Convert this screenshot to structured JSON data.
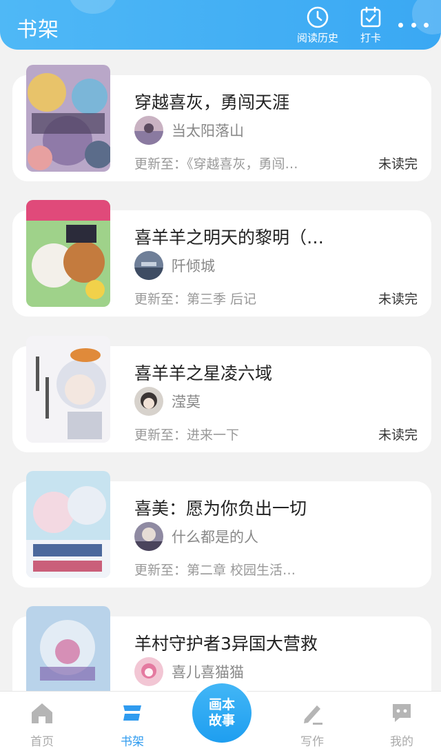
{
  "header": {
    "title": "书架",
    "history_label": "阅读历史",
    "checkin_label": "打卡"
  },
  "books": [
    {
      "title": "穿越喜灰，勇闯天涯",
      "author": "当太阳落山",
      "update": "更新至：《穿越喜灰，勇闯…",
      "status": "未读完"
    },
    {
      "title": "喜羊羊之明天的黎明（…",
      "author": "阡倾城",
      "update": "更新至：第三季 后记",
      "status": "未读完"
    },
    {
      "title": "喜羊羊之星凌六域",
      "author": "滢莫",
      "update": "更新至：进来一下",
      "status": "未读完"
    },
    {
      "title": "喜美：愿为你负出一切",
      "author": "什么都是的人",
      "update": "更新至：第二章  校园生活…",
      "status": ""
    },
    {
      "title": "羊村守护者3异国大营救",
      "author": "喜儿喜猫猫",
      "update": "",
      "status": ""
    }
  ],
  "nav": {
    "home": "首页",
    "shelf": "书架",
    "center_line1": "画本",
    "center_line2": "故事",
    "write": "写作",
    "me": "我的"
  },
  "colors": {
    "accent": "#3aa8f3",
    "inactive": "#aaaaaa"
  }
}
